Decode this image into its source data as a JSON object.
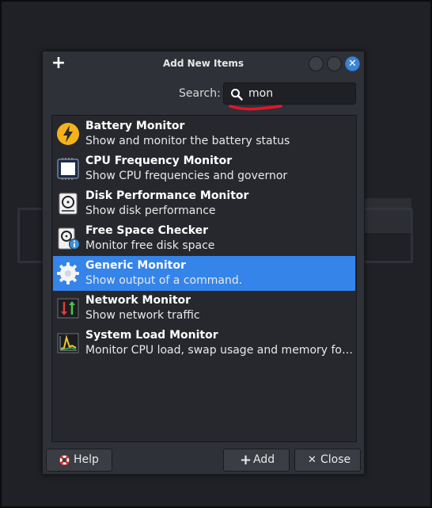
{
  "dialog": {
    "title": "Add New Items",
    "window_buttons": [
      "minimize",
      "maximize",
      "close"
    ],
    "close_glyph": "✕"
  },
  "search": {
    "label": "Search:",
    "value": "mon",
    "annotation_color": "#e8132a"
  },
  "items": [
    {
      "title": "Battery Monitor",
      "description": "Show and monitor the battery status",
      "icon": "battery-lightning-icon",
      "selected": false
    },
    {
      "title": "CPU Frequency Monitor",
      "description": "Show CPU frequencies and governor",
      "icon": "cpu-chip-icon",
      "selected": false
    },
    {
      "title": "Disk Performance Monitor",
      "description": "Show disk performance",
      "icon": "hard-disk-icon",
      "selected": false
    },
    {
      "title": "Free Space Checker",
      "description": "Monitor free disk space",
      "icon": "disk-info-icon",
      "selected": false
    },
    {
      "title": "Generic Monitor",
      "description": "Show output of a command.",
      "icon": "gear-icon",
      "selected": true
    },
    {
      "title": "Network Monitor",
      "description": "Show network traffic",
      "icon": "network-arrows-icon",
      "selected": false
    },
    {
      "title": "System Load Monitor",
      "description": "Monitor CPU load, swap usage and memory footp…",
      "icon": "load-graph-icon",
      "selected": false
    }
  ],
  "buttons": {
    "help": "Help",
    "add": "Add",
    "close": "Close"
  },
  "colors": {
    "accent": "#3484e9",
    "dialog_bg": "#2e3137",
    "list_bg": "#26282d"
  }
}
